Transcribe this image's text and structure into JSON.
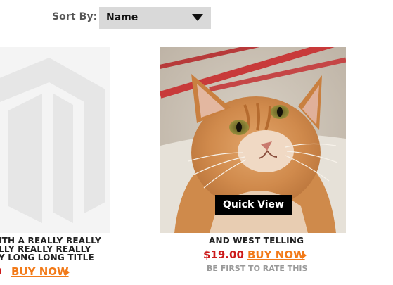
{
  "sort": {
    "label": "Sort By:",
    "selected": "Name"
  },
  "products": [
    {
      "title_lines": [
        "ITH A REALLY REALLY",
        "LLY REALLY REALLY",
        "Y LONG LONG TITLE"
      ],
      "price": "0",
      "buy_label": "BUY NOW",
      "image_icon": "placeholder-logo-icon"
    },
    {
      "title_lines": [
        "AND WEST TELLING"
      ],
      "price": "$19.00",
      "buy_label": "BUY NOW",
      "quick_view_label": "Quick View",
      "rate_label": "BE FIRST TO RATE THIS",
      "image_icon": "cat-photo"
    }
  ],
  "colors": {
    "price": "#cc1a1a",
    "buy_now": "#f27a18",
    "select_bg": "#d9d9d9"
  }
}
